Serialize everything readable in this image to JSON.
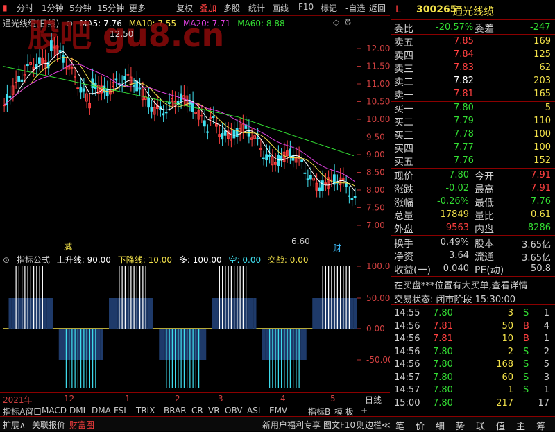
{
  "toolbar": {
    "items": [
      "分时",
      "1分钟",
      "5分钟",
      "15分钟",
      "更多",
      "复权",
      "叠加",
      "多股",
      "统计",
      "画线",
      "F10",
      "标记",
      "-自选",
      "返回"
    ]
  },
  "chart": {
    "title": "通光线缆(日线)",
    "ma5": "MA5: 7.76",
    "ma10": "MA10: 7.55",
    "ma20": "MA20: 7.71",
    "ma60": "MA60: 8.88",
    "high_label": "12.50",
    "low_label": "6.60",
    "jian": "减",
    "cai": "财",
    "yticks": [
      "12.00",
      "11.50",
      "11.00",
      "10.50",
      "10.00",
      "9.50",
      "9.00",
      "8.50",
      "8.00",
      "7.50",
      "7.00"
    ],
    "watermark": "股吧 gu8.cn"
  },
  "indicator": {
    "label": "指标公式",
    "up": "上升线: 90.00",
    "down": "下降线: 10.00",
    "duo": "多: 100.00",
    "kong": "空: 0.00",
    "jz": "交战: 0.00",
    "yticks": [
      "100.00",
      "50.00",
      "0.00",
      "-50.00"
    ]
  },
  "xaxis": {
    "labels": [
      "2021年",
      "12",
      "1",
      "2",
      "3",
      "4",
      "5"
    ],
    "right": "日线"
  },
  "tabs": [
    "指标A",
    "窗口",
    "MACD",
    "DMI",
    "DMA",
    "FSL",
    "TRIX",
    "BRAR",
    "CR",
    "VR",
    "OBV",
    "ASI",
    "EMV"
  ],
  "tabs_right": [
    "指标B",
    "模 板",
    "+",
    "-"
  ],
  "bottom": {
    "left": [
      "扩展∧",
      "关联报价",
      "财富圈"
    ],
    "mid": [
      "新用户福利专享",
      "图文F10",
      "则边栏≪"
    ],
    "right": [
      "笔",
      "价",
      "细",
      "势",
      "联",
      "值",
      "主",
      "筹"
    ]
  },
  "quote": {
    "l": "L",
    "code": "300265",
    "name": "通光线缆",
    "weibi_l": "委比",
    "weibi_v": "-20.57%",
    "weicha_l": "委差",
    "weicha_v": "-247",
    "sells": [
      {
        "l": "卖五",
        "p": "7.85",
        "v": "169"
      },
      {
        "l": "卖四",
        "p": "7.84",
        "v": "125"
      },
      {
        "l": "卖三",
        "p": "7.83",
        "v": "62"
      },
      {
        "l": "卖二",
        "p": "7.82",
        "v": "203"
      },
      {
        "l": "卖一",
        "p": "7.81",
        "v": "165"
      }
    ],
    "buys": [
      {
        "l": "买一",
        "p": "7.80",
        "v": "5"
      },
      {
        "l": "买二",
        "p": "7.79",
        "v": "110"
      },
      {
        "l": "买三",
        "p": "7.78",
        "v": "100"
      },
      {
        "l": "买四",
        "p": "7.77",
        "v": "100"
      },
      {
        "l": "买五",
        "p": "7.76",
        "v": "152"
      }
    ],
    "stats": [
      {
        "a": "现价",
        "b": "7.80",
        "c": "今开",
        "d": "7.91"
      },
      {
        "a": "涨跌",
        "b": "-0.02",
        "c": "最高",
        "d": "7.91"
      },
      {
        "a": "涨幅",
        "b": "-0.26%",
        "c": "最低",
        "d": "7.76"
      },
      {
        "a": "总量",
        "b": "17849",
        "c": "量比",
        "d": "0.61"
      },
      {
        "a": "外盘",
        "b": "9563",
        "c": "内盘",
        "d": "8286"
      }
    ],
    "stats2": [
      {
        "a": "换手",
        "b": "0.49%",
        "c": "股本",
        "d": "3.65亿"
      },
      {
        "a": "净资",
        "b": "3.64",
        "c": "流通",
        "d": "3.65亿"
      },
      {
        "a": "收益(一)",
        "b": "0.040",
        "c": "PE(动)",
        "d": "50.8"
      }
    ],
    "notice": "在买盘***位置有大买单,查看详情",
    "status": "交易状态: 闭市阶段 15:30:00",
    "ticks": [
      {
        "t": "14:55",
        "p": "7.80",
        "v": "3",
        "d": "S",
        "n": "1"
      },
      {
        "t": "14:56",
        "p": "7.81",
        "v": "50",
        "d": "B",
        "n": "4"
      },
      {
        "t": "14:56",
        "p": "7.81",
        "v": "10",
        "d": "B",
        "n": "1"
      },
      {
        "t": "14:56",
        "p": "7.80",
        "v": "2",
        "d": "S",
        "n": "2"
      },
      {
        "t": "14:56",
        "p": "7.80",
        "v": "168",
        "d": "S",
        "n": "5"
      },
      {
        "t": "14:57",
        "p": "7.80",
        "v": "60",
        "d": "S",
        "n": "3"
      },
      {
        "t": "14:57",
        "p": "7.80",
        "v": "1",
        "d": "S",
        "n": "1"
      },
      {
        "t": "15:00",
        "p": "7.80",
        "v": "217",
        "d": "",
        "n": "17"
      }
    ]
  }
}
